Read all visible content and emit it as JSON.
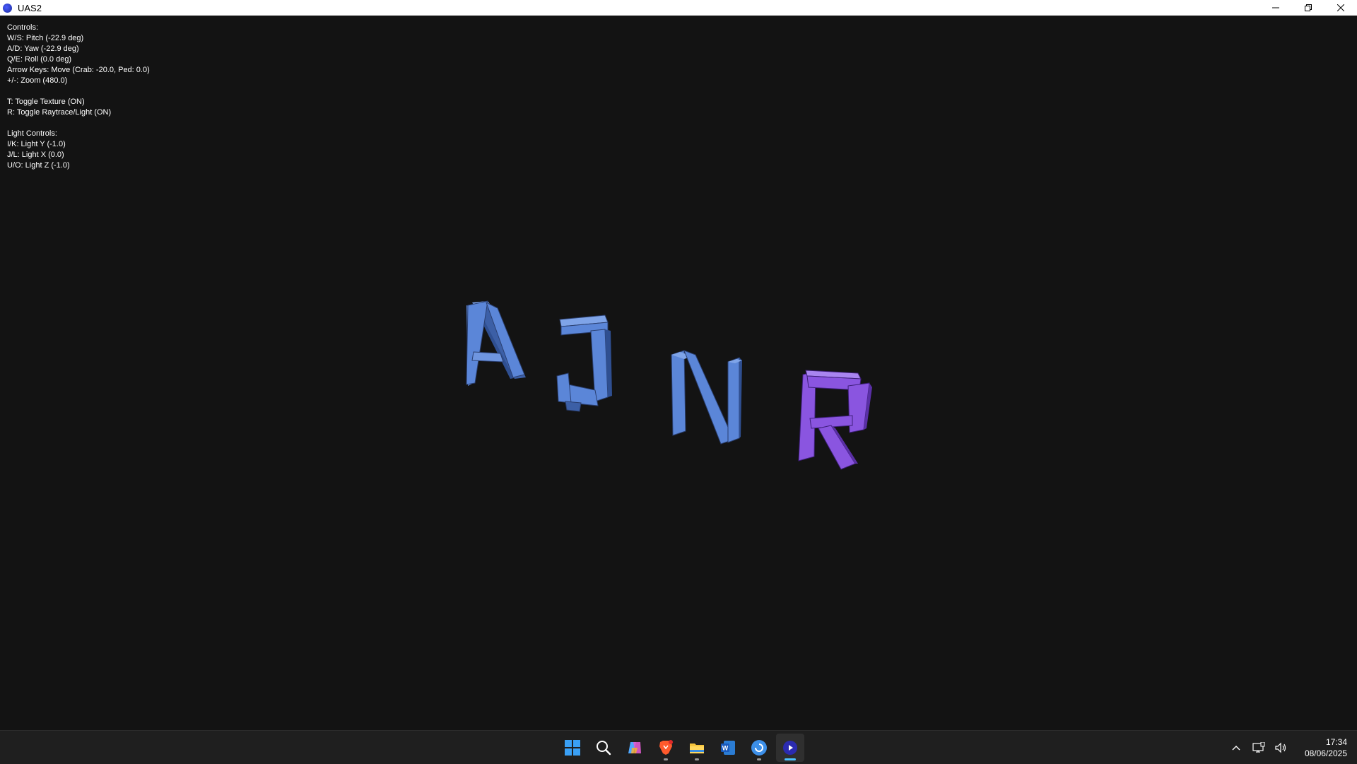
{
  "window": {
    "title": "UAS2",
    "icon": "app-circle-icon"
  },
  "hud": {
    "controls_header": "Controls:",
    "pitch": "W/S: Pitch (-22.9 deg)",
    "yaw": "A/D: Yaw (-22.9 deg)",
    "roll": "Q/E: Roll (0.0 deg)",
    "move": "Arrow Keys: Move (Crab: -20.0, Ped: 0.0)",
    "zoom": "+/-: Zoom (480.0)",
    "texture": "T: Toggle Texture (ON)",
    "raytrace": "R: Toggle Raytrace/Light (ON)",
    "light_header": "Light Controls:",
    "light_y": "I/K: Light Y (-1.0)",
    "light_x": "J/L: Light X (0.0)",
    "light_z": "U/O: Light Z (-1.0)"
  },
  "scene": {
    "letters": [
      "A",
      "J",
      "N",
      "R"
    ],
    "colors": {
      "blue_face": "#5b86d8",
      "blue_side": "#2f4f91",
      "blue_top": "#7fa4e8",
      "purple_face": "#8a55e0",
      "purple_side": "#5a2fa6",
      "purple_top": "#a985f0"
    }
  },
  "taskbar": {
    "apps": [
      {
        "name": "start",
        "icon": "windows-logo-icon"
      },
      {
        "name": "search",
        "icon": "search-icon"
      },
      {
        "name": "copilot",
        "icon": "copilot-icon"
      },
      {
        "name": "brave",
        "icon": "brave-browser-icon"
      },
      {
        "name": "file-explorer",
        "icon": "folder-icon"
      },
      {
        "name": "word",
        "icon": "word-icon"
      },
      {
        "name": "app",
        "icon": "blue-circle-app-icon"
      },
      {
        "name": "uas2",
        "icon": "uas2-app-icon"
      }
    ],
    "tray": {
      "icons": [
        "chevron-up-icon",
        "network-icon",
        "volume-icon"
      ],
      "time": "17:34",
      "date": "08/06/2025"
    }
  }
}
